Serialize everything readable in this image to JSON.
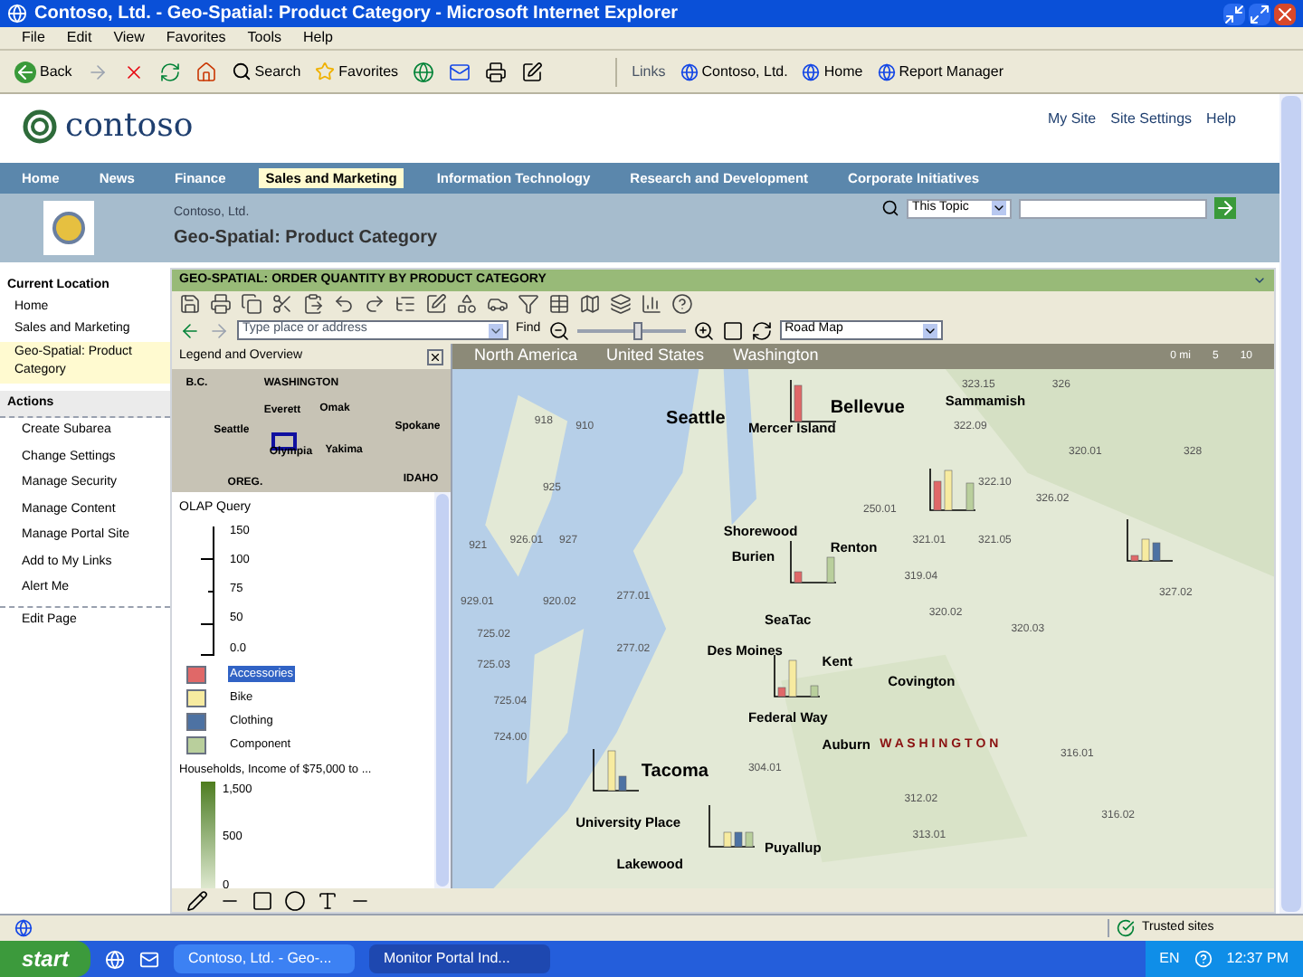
{
  "window": {
    "title": "Contoso, Ltd. - Geo-Spatial: Product Category - Microsoft Internet Explorer"
  },
  "menu": [
    "File",
    "Edit",
    "View",
    "Favorites",
    "Tools",
    "Help"
  ],
  "toolbar": {
    "back": "Back",
    "search": "Search",
    "favorites": "Favorites",
    "links_label": "Links",
    "links": [
      "Contoso, Ltd.",
      "Home",
      "Report Manager"
    ]
  },
  "site": {
    "logo": "contoso",
    "top_links": [
      "My Site",
      "Site Settings",
      "Help"
    ]
  },
  "nav": [
    {
      "label": "Home",
      "selected": false
    },
    {
      "label": "News",
      "selected": false
    },
    {
      "label": "Finance",
      "selected": false
    },
    {
      "label": "Sales and Marketing",
      "selected": true
    },
    {
      "label": "Information Technology",
      "selected": false
    },
    {
      "label": "Research and Development",
      "selected": false
    },
    {
      "label": "Corporate Initiatives",
      "selected": false
    }
  ],
  "page_header": {
    "breadcrumb": "Contoso, Ltd.",
    "title": "Geo-Spatial: Product Category",
    "search_scope": "This Topic"
  },
  "sidebar": {
    "location_heading": "Current Location",
    "location": [
      {
        "label": "Home",
        "selected": false
      },
      {
        "label": "Sales and Marketing",
        "selected": false
      },
      {
        "label": "Geo-Spatial: Product Category",
        "selected": true
      }
    ],
    "actions_heading": "Actions",
    "actions": [
      "Create Subarea",
      "Change Settings",
      "Manage Security",
      "Manage Content",
      "Manage Portal Site",
      "Add to My Links",
      "Alert Me"
    ],
    "edit": "Edit Page"
  },
  "webpart": {
    "title": "GEO-SPATIAL: ORDER QUANTITY BY PRODUCT CATEGORY",
    "address_placeholder": "Type place or address",
    "find": "Find",
    "map_style": "Road Map",
    "legend_title": "Legend and Overview",
    "overview_labels": [
      "B.C.",
      "WASHINGTON",
      "Everett",
      "Seattle",
      "Omak",
      "Spokane",
      "Olympia",
      "Yakima",
      "OREG.",
      "IDAHO"
    ],
    "zoom_slider": {
      "level": 0.55
    },
    "query_title": "OLAP Query",
    "scale": [
      "150",
      "100",
      "75",
      "50",
      "0.0"
    ],
    "categories": [
      {
        "label": "Accessories",
        "color": "#e06868",
        "selected": true
      },
      {
        "label": "Bike",
        "color": "#f7eba0",
        "selected": false
      },
      {
        "label": "Clothing",
        "color": "#4d72a3",
        "selected": false
      },
      {
        "label": "Component",
        "color": "#b9cf9c",
        "selected": false
      }
    ],
    "layer_title": "Households, Income of $75,000 to ...",
    "layer_scale": [
      "1,500",
      "500",
      "0"
    ],
    "breadcrumb": [
      "North America",
      "United States",
      "Washington"
    ],
    "map_scale": [
      "0 mi",
      "5",
      "10"
    ],
    "places": [
      {
        "text": "Seattle",
        "kind": "city"
      },
      {
        "text": "Bellevue",
        "kind": "city"
      },
      {
        "text": "Mercer Island",
        "kind": "town"
      },
      {
        "text": "Sammamish",
        "kind": "town"
      },
      {
        "text": "Shorewood",
        "kind": "town"
      },
      {
        "text": "Burien",
        "kind": "town"
      },
      {
        "text": "Renton",
        "kind": "town"
      },
      {
        "text": "SeaTac",
        "kind": "town"
      },
      {
        "text": "Des Moines",
        "kind": "town"
      },
      {
        "text": "Kent",
        "kind": "town"
      },
      {
        "text": "Covington",
        "kind": "town"
      },
      {
        "text": "Federal Way",
        "kind": "town"
      },
      {
        "text": "Auburn",
        "kind": "town"
      },
      {
        "text": "W A S H I N G T O N",
        "kind": "state"
      },
      {
        "text": "Tacoma",
        "kind": "city"
      },
      {
        "text": "University Place",
        "kind": "town"
      },
      {
        "text": "Puyallup",
        "kind": "town"
      },
      {
        "text": "Lakewood",
        "kind": "town"
      },
      {
        "text": "323.15",
        "kind": "tract"
      },
      {
        "text": "326",
        "kind": "tract"
      },
      {
        "text": "322.09",
        "kind": "tract"
      },
      {
        "text": "320.01",
        "kind": "tract"
      },
      {
        "text": "328",
        "kind": "tract"
      },
      {
        "text": "322.10",
        "kind": "tract"
      },
      {
        "text": "326.02",
        "kind": "tract"
      },
      {
        "text": "250.01",
        "kind": "tract"
      },
      {
        "text": "321.01",
        "kind": "tract"
      },
      {
        "text": "321.05",
        "kind": "tract"
      },
      {
        "text": "319.04",
        "kind": "tract"
      },
      {
        "text": "327.02",
        "kind": "tract"
      },
      {
        "text": "320.02",
        "kind": "tract"
      },
      {
        "text": "320.03",
        "kind": "tract"
      },
      {
        "text": "316.01",
        "kind": "tract"
      },
      {
        "text": "312.02",
        "kind": "tract"
      },
      {
        "text": "316.02",
        "kind": "tract"
      },
      {
        "text": "313.01",
        "kind": "tract"
      },
      {
        "text": "918",
        "kind": "tract"
      },
      {
        "text": "910",
        "kind": "tract"
      },
      {
        "text": "925",
        "kind": "tract"
      },
      {
        "text": "921",
        "kind": "tract"
      },
      {
        "text": "926.01",
        "kind": "tract"
      },
      {
        "text": "927",
        "kind": "tract"
      },
      {
        "text": "929.01",
        "kind": "tract"
      },
      {
        "text": "920.02",
        "kind": "tract"
      },
      {
        "text": "277.01",
        "kind": "tract"
      },
      {
        "text": "725.02",
        "kind": "tract"
      },
      {
        "text": "277.02",
        "kind": "tract"
      },
      {
        "text": "725.03",
        "kind": "tract"
      },
      {
        "text": "725.04",
        "kind": "tract"
      },
      {
        "text": "724.00",
        "kind": "tract"
      },
      {
        "text": "304.01",
        "kind": "tract"
      }
    ]
  },
  "status_bar": {
    "zone": "Trusted sites"
  },
  "taskbar": {
    "start": "start",
    "tasks": [
      {
        "label": "Contoso, Ltd. - Geo-...",
        "selected": false
      },
      {
        "label": "Monitor Portal Ind...",
        "selected": true
      }
    ],
    "lang": "EN",
    "clock": "12:37 PM"
  }
}
